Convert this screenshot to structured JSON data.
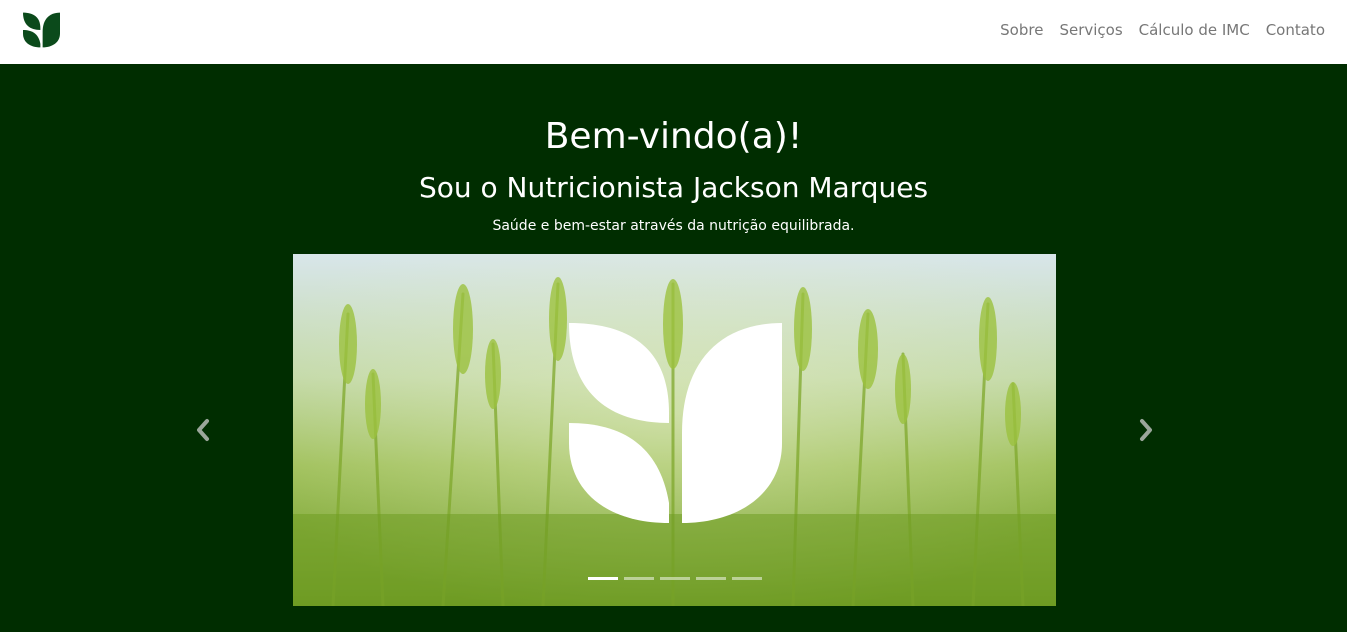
{
  "navbar": {
    "brand_icon": "leaf-logo-icon",
    "brand_color": "#0b4a1b",
    "items": [
      {
        "label": "Sobre"
      },
      {
        "label": "Serviços"
      },
      {
        "label": "Cálculo de IMC"
      },
      {
        "label": "Contato"
      }
    ]
  },
  "hero": {
    "background": "#002d00",
    "title": "Bem-vindo(a)!",
    "subtitle": "Sou o Nutricionista Jackson Marques",
    "tagline": "Saúde e bem-estar através da nutrição equilibrada."
  },
  "carousel": {
    "slide_icon": "leaf-logo-icon",
    "slide_count": 5,
    "active_index": 0,
    "prev_icon": "chevron-left-icon",
    "next_icon": "chevron-right-icon"
  }
}
